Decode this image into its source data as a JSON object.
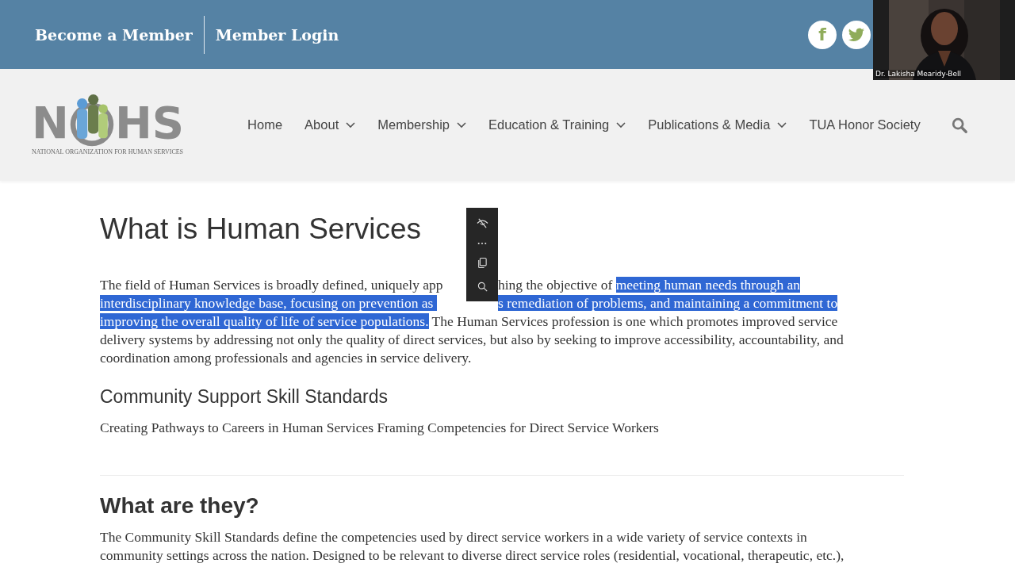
{
  "top_bar": {
    "links": [
      "Become a Member",
      "Member Login"
    ],
    "social": [
      {
        "kind": "facebook",
        "label": "f"
      },
      {
        "kind": "twitter"
      }
    ]
  },
  "video_tile": {
    "kind": "picture",
    "caption": "Dr. Lakisha Mearidy-Bell"
  },
  "logo": {
    "left": "N",
    "right": "HS",
    "tagline": "NATIONAL ORGANIZATION FOR HUMAN SERVICES"
  },
  "nav": {
    "items": [
      {
        "label": "Home",
        "dropdown": false
      },
      {
        "label": "About",
        "dropdown": true
      },
      {
        "label": "Membership",
        "dropdown": true
      },
      {
        "label": "Education & Training",
        "dropdown": true
      },
      {
        "label": "Publications & Media",
        "dropdown": true
      },
      {
        "label": "TUA Honor Society",
        "dropdown": false
      }
    ]
  },
  "content": {
    "title": "What is Human Services",
    "intro_lines": [
      {
        "kind": "split",
        "left": [
          {
            "text": "The field of Human Services is broadly defined, uniquely app",
            "selected": false
          }
        ],
        "right": [
          {
            "text": "hing the objective of ",
            "selected": false
          },
          {
            "text": "meeting human needs through an",
            "selected": true
          }
        ]
      },
      {
        "kind": "split",
        "left": [
          {
            "text": "interdisciplinary knowledge base, focusing on prevention as ",
            "selected": true
          }
        ],
        "right": [
          {
            "text": "s remediation of problems, and maintaining a commitment to",
            "selected": true
          }
        ]
      },
      {
        "kind": "full",
        "segments": [
          {
            "text": "improving the overall quality of life of service populations.",
            "selected": true
          },
          {
            "text": " The Human Services profession is one which promotes improved service",
            "selected": false
          }
        ]
      },
      {
        "kind": "full",
        "segments": [
          {
            "text": "delivery systems by addressing not only the quality of direct services, but also by seeking to improve accessibility, accountability, and",
            "selected": false
          }
        ]
      },
      {
        "kind": "full",
        "segments": [
          {
            "text": "coordination among professionals and agencies in service delivery.",
            "selected": false
          }
        ]
      }
    ],
    "subtitle": "Community Support Skill Standards",
    "subtext": "Creating Pathways to Careers in Human Services Framing Competencies for Direct Service Workers",
    "section_title": "What are they?",
    "section_lines": [
      "The Community Skill Standards define the competencies used by direct service workers in a wide variety of service contexts in",
      "community settings across the nation. Designed to be relevant to diverse direct service roles (residential, vocational, therapeutic, etc.),"
    ]
  },
  "selection_toolbar": {
    "items": [
      {
        "kind": "hide"
      },
      {
        "kind": "more"
      },
      {
        "kind": "copy"
      },
      {
        "kind": "search"
      }
    ]
  }
}
